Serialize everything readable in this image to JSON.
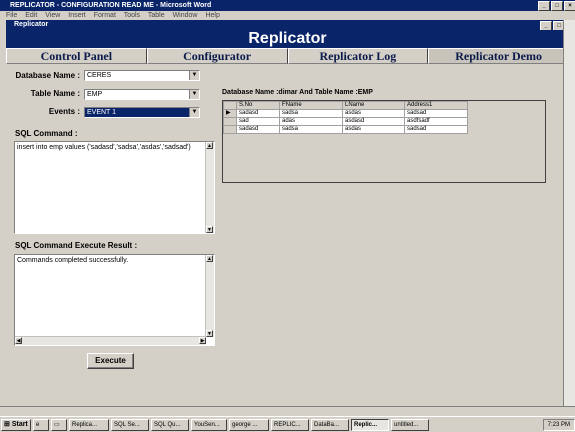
{
  "word": {
    "title": "REPLICATOR - CONFIGURATION READ ME - Microsoft Word",
    "menu": [
      "File",
      "Edit",
      "View",
      "Insert",
      "Format",
      "Tools",
      "Table",
      "Window",
      "Help"
    ]
  },
  "app": {
    "window_title": "Replicator",
    "banner": "Replicator"
  },
  "tabs": [
    "Control Panel",
    "Configurator",
    "Replicator Log",
    "Replicator Demo"
  ],
  "form": {
    "database_label": "Database Name :",
    "database_value": "CERES",
    "table_label": "Table Name :",
    "table_value": "EMP",
    "events_label": "Events :",
    "events_value": "EVENT 1",
    "sql_label": "SQL Command :",
    "sql_value": "insert into emp values ('sadasd','sadsa','asdas','sadsad')",
    "result_label": "SQL Command Execute Result :",
    "result_value": "Commands completed successfully.",
    "execute_label": "Execute"
  },
  "grid": {
    "caption": "Database Name :dimar And Table Name :EMP",
    "columns": [
      "S.No",
      "FName",
      "LName",
      "Address1"
    ],
    "rows": [
      [
        "sadasd",
        "sadsa",
        "asdas",
        "sadsad"
      ],
      [
        "sad",
        "adas",
        "asdasd",
        "asdfsadf"
      ],
      [
        "sadasd",
        "sadsa",
        "asdas",
        "sadsad"
      ]
    ]
  },
  "taskbar": {
    "start": "Start",
    "items": [
      "Replica...",
      "SQL Se...",
      "SQL Qu...",
      "YouSen...",
      "george ...",
      "REPLIC...",
      "DataBa...",
      "Replic...",
      "untitled..."
    ],
    "active_index": 7,
    "clock": "7:23 PM"
  }
}
